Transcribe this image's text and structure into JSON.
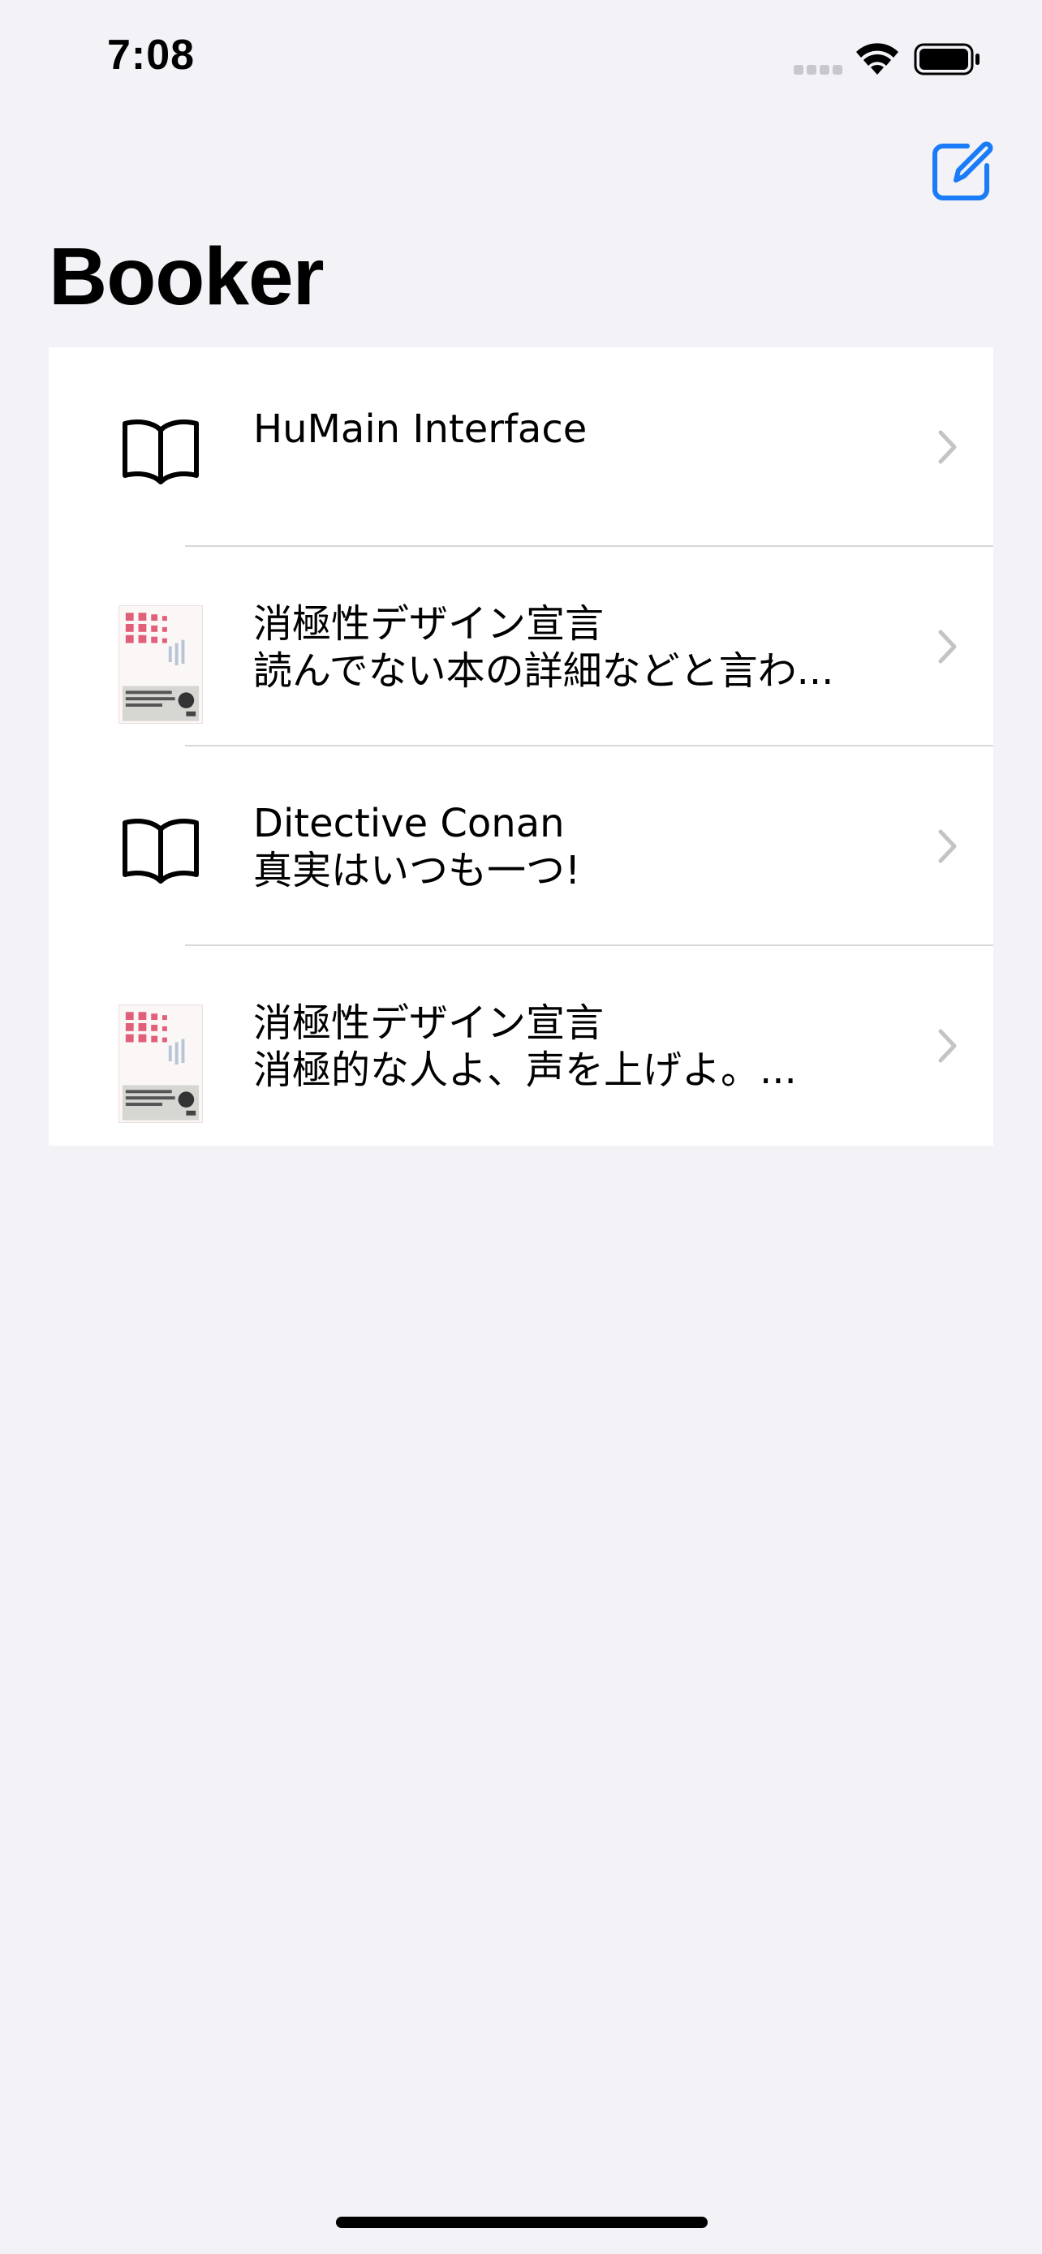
{
  "status_bar": {
    "time": "7:08"
  },
  "nav": {
    "title": "Booker",
    "compose_icon": "compose-icon",
    "accent_color": "#1a7cf7"
  },
  "books": [
    {
      "title": "HuMain Interface",
      "subtitle": "",
      "icon": "book-icon"
    },
    {
      "title": "消極性デザイン宣言",
      "subtitle": "読んでない本の詳細などと言わ...",
      "icon": "cover-thumbnail"
    },
    {
      "title": "Ditective Conan",
      "subtitle": "真実はいつも一つ!",
      "icon": "book-icon"
    },
    {
      "title": "消極性デザイン宣言",
      "subtitle": "消極的な人よ、声を上げよ。...",
      "icon": "cover-thumbnail"
    }
  ]
}
